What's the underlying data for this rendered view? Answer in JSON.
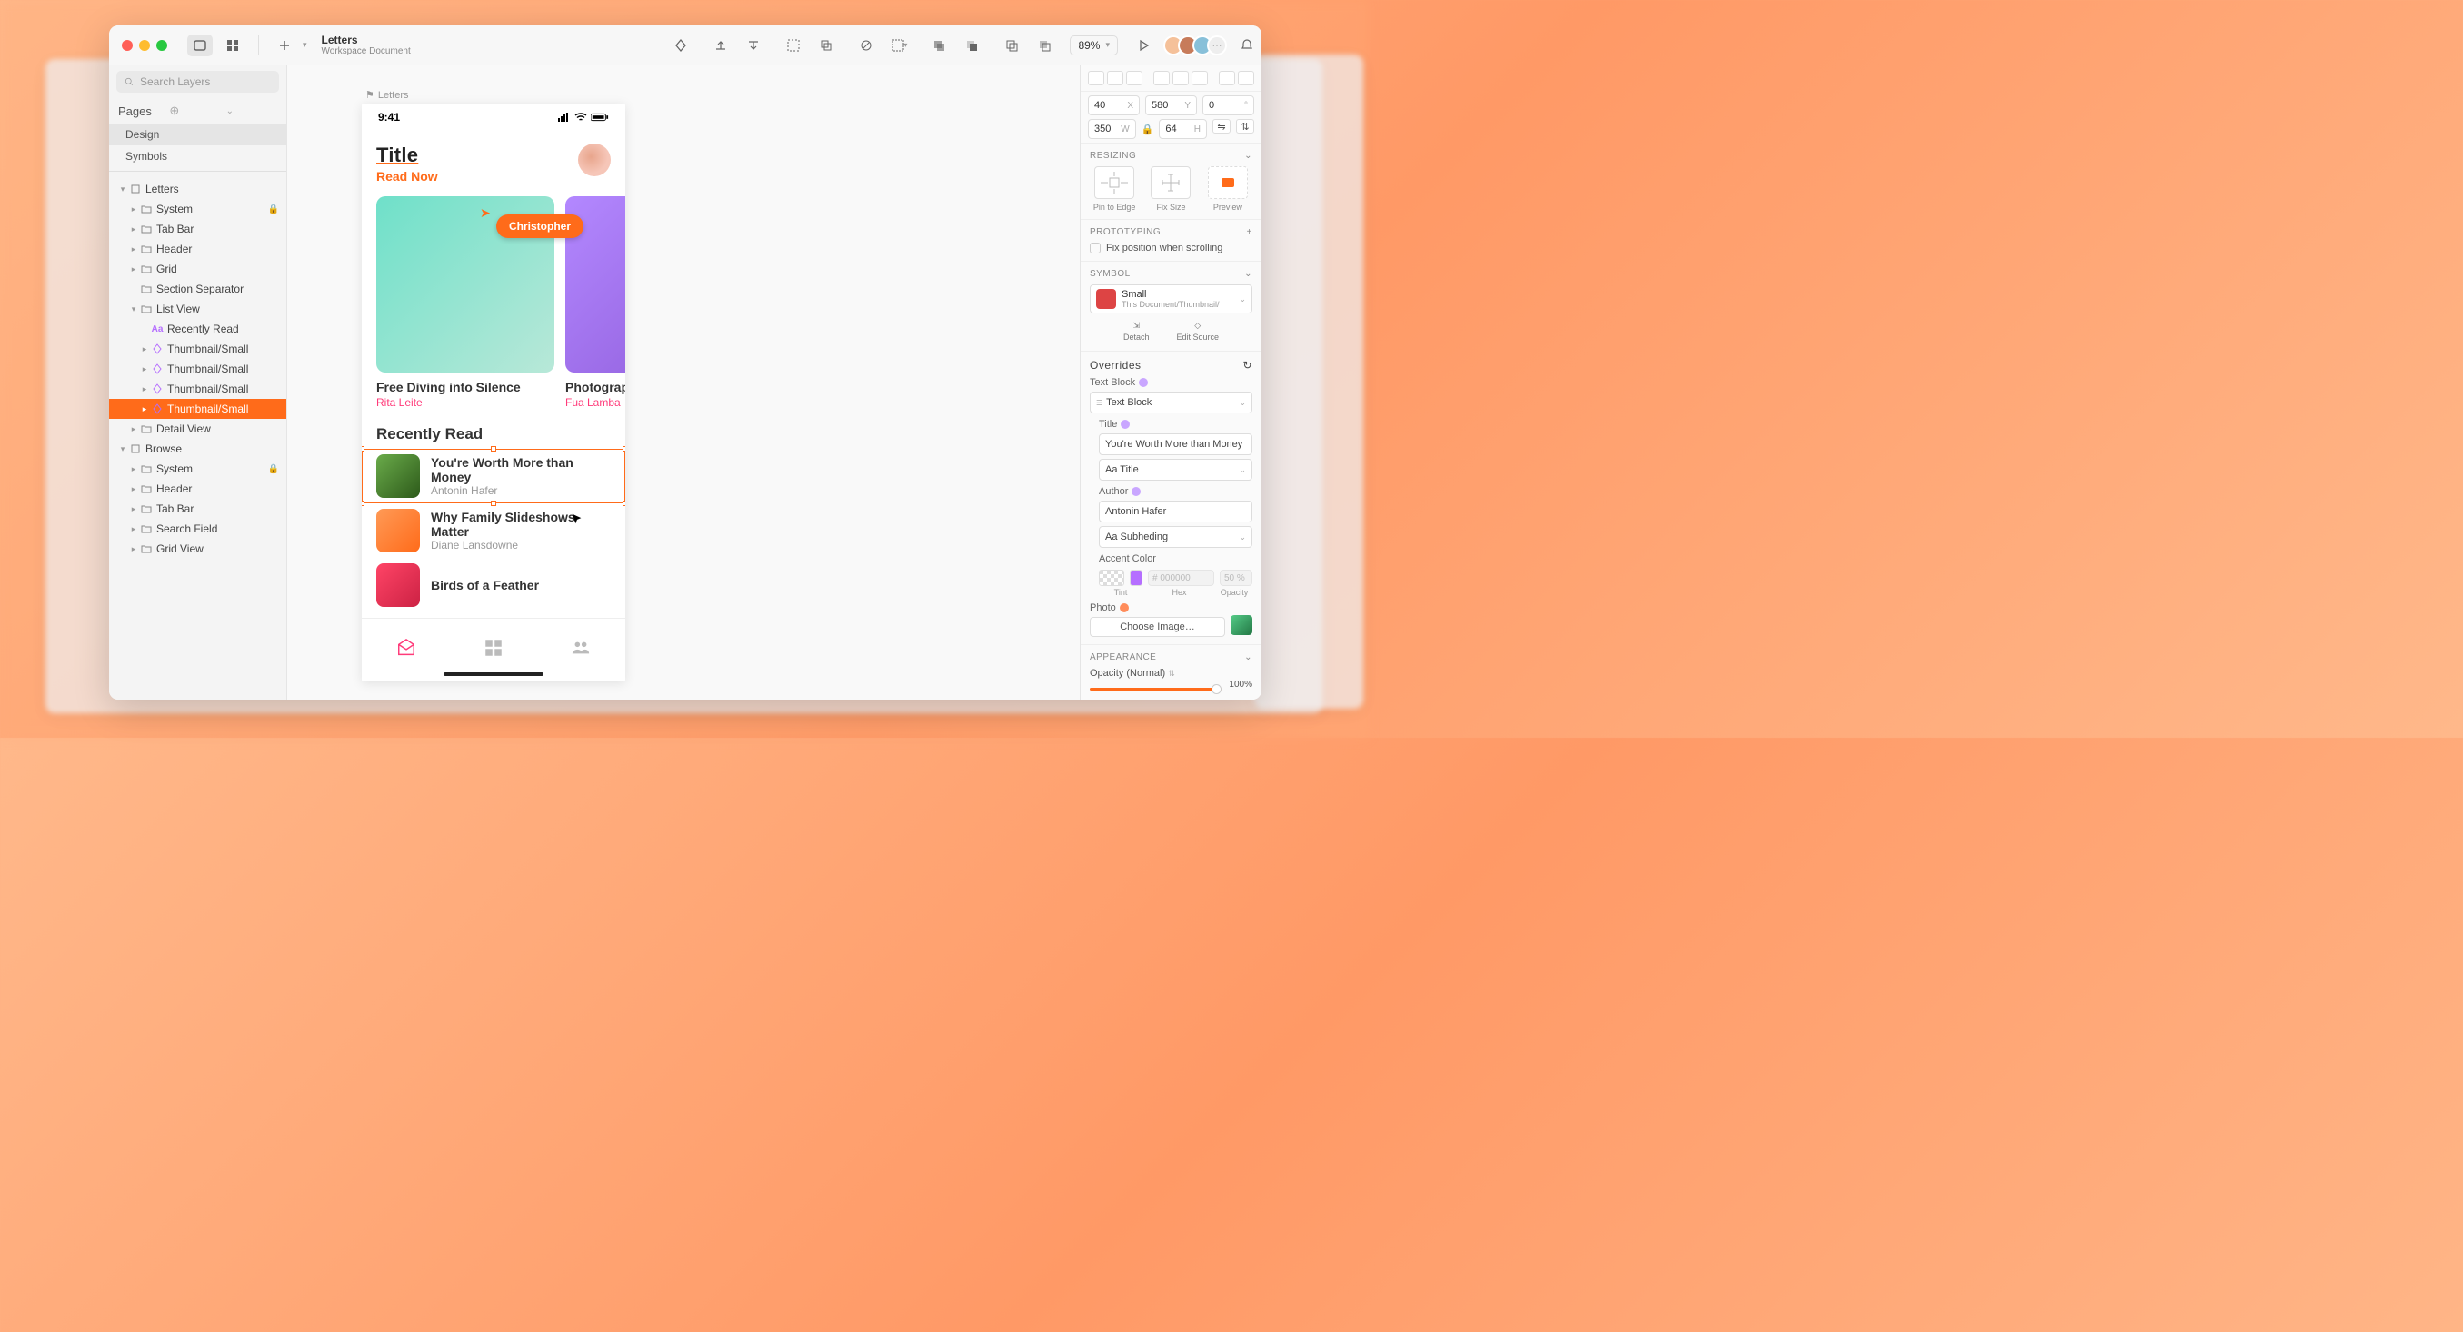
{
  "toolbar": {
    "title": "Letters",
    "subtitle": "Workspace Document",
    "zoom": "89%",
    "traffic": [
      "#ff5f57",
      "#febc2e",
      "#28c840"
    ],
    "collab_colors": [
      "#f5c19a",
      "#c77b5a",
      "#88c0d9"
    ]
  },
  "left": {
    "search_placeholder": "Search Layers",
    "pages_label": "Pages",
    "pages": [
      "Design",
      "Symbols"
    ],
    "tree": [
      {
        "ind": 1,
        "disc": "▾",
        "kind": "artb",
        "name": "Letters"
      },
      {
        "ind": 2,
        "disc": "▸",
        "kind": "grp",
        "name": "System",
        "lock": true
      },
      {
        "ind": 2,
        "disc": "▸",
        "kind": "grp",
        "name": "Tab Bar"
      },
      {
        "ind": 2,
        "disc": "▸",
        "kind": "grp",
        "name": "Header"
      },
      {
        "ind": 2,
        "disc": "▸",
        "kind": "grp",
        "name": "Grid"
      },
      {
        "ind": 2,
        "disc": "",
        "kind": "grp",
        "name": "Section Separator"
      },
      {
        "ind": 2,
        "disc": "▾",
        "kind": "grp",
        "name": "List View"
      },
      {
        "ind": 3,
        "disc": "",
        "kind": "txt",
        "name": "Recently Read"
      },
      {
        "ind": 3,
        "disc": "▸",
        "kind": "sym",
        "name": "Thumbnail/Small"
      },
      {
        "ind": 3,
        "disc": "▸",
        "kind": "sym",
        "name": "Thumbnail/Small"
      },
      {
        "ind": 3,
        "disc": "▸",
        "kind": "sym",
        "name": "Thumbnail/Small"
      },
      {
        "ind": 3,
        "disc": "▸",
        "kind": "sym",
        "name": "Thumbnail/Small",
        "sel": true
      },
      {
        "ind": 2,
        "disc": "▸",
        "kind": "grp",
        "name": "Detail View"
      },
      {
        "ind": 1,
        "disc": "▾",
        "kind": "artb",
        "name": "Browse"
      },
      {
        "ind": 2,
        "disc": "▸",
        "kind": "grp",
        "name": "System",
        "lock": true
      },
      {
        "ind": 2,
        "disc": "▸",
        "kind": "grp",
        "name": "Header"
      },
      {
        "ind": 2,
        "disc": "▸",
        "kind": "grp",
        "name": "Tab Bar"
      },
      {
        "ind": 2,
        "disc": "▸",
        "kind": "grp",
        "name": "Search Field"
      },
      {
        "ind": 2,
        "disc": "▸",
        "kind": "grp",
        "name": "Grid View"
      }
    ]
  },
  "canvas": {
    "artboard_label": "Letters",
    "status_time": "9:41",
    "hero_title": "Title",
    "hero_sub": "Read Now",
    "collab_name": "Christopher",
    "cards": [
      {
        "title": "Free Diving into Silence",
        "author": "Rita Leite",
        "bg": "linear-gradient(135deg,#6fe0c9,#b8e8d8)"
      },
      {
        "title": "Photographi…",
        "author": "Fua Lamba",
        "bg": "linear-gradient(135deg,#b388ff,#8e5bd9)"
      }
    ],
    "section": "Recently Read",
    "list": [
      {
        "title": "You're Worth More than Money",
        "author": "Antonin Hafer",
        "bg": "linear-gradient(135deg,#6aab4a,#2d5a1a)",
        "sel": true
      },
      {
        "title": "Why Family Slideshows Matter",
        "author": "Diane Lansdowne",
        "bg": "linear-gradient(135deg,#ff9a56,#ff6b1a)"
      },
      {
        "title": "Birds of a Feather",
        "author": "",
        "bg": "linear-gradient(135deg,#ff4466,#cc2244)"
      }
    ]
  },
  "right": {
    "x": "40",
    "y": "580",
    "rot": "0",
    "w": "350",
    "h": "64",
    "resizing_label": "RESIZING",
    "resize_opts": [
      "Pin to Edge",
      "Fix Size",
      "Preview"
    ],
    "proto_label": "PROTOTYPING",
    "fix_scroll": "Fix position when scrolling",
    "symbol_label": "SYMBOL",
    "symbol_name": "Small",
    "symbol_path": "This Document/Thumbnail/",
    "detach": "Detach",
    "edit_source": "Edit Source",
    "overrides_label": "Overrides",
    "text_block": "Text Block",
    "text_block_val": "Text Block",
    "title_label": "Title",
    "title_val": "You're Worth More than Money",
    "title_style": "Aa Title",
    "author_label": "Author",
    "author_val": "Antonin Hafer",
    "author_style": "Aa Subheding",
    "accent_label": "Accent Color",
    "hex_placeholder": "# 000000",
    "opacity_placeholder": "50 %",
    "tint": "Tint",
    "hex": "Hex",
    "opacity": "Opacity",
    "photo_label": "Photo",
    "choose": "Choose Image…",
    "appearance_label": "APPEARANCE",
    "opacity_mode": "Opacity (Normal)",
    "opacity_val": "100%"
  }
}
